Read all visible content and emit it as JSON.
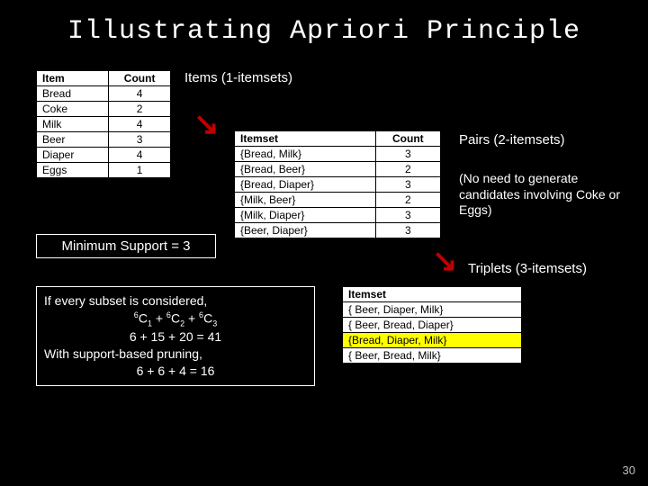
{
  "title": "Illustrating Apriori Principle",
  "labels": {
    "items": "Items (1-itemsets)",
    "pairs": "Pairs (2-itemsets)",
    "triplets": "Triplets (3-itemsets)",
    "note_coke": "(No need to generate candidates involving Coke or Eggs)",
    "minsupport": "Minimum Support = 3"
  },
  "items_table": {
    "headers": [
      "Item",
      "Count"
    ],
    "rows": [
      {
        "item": "Bread",
        "count": "4"
      },
      {
        "item": "Coke",
        "count": "2"
      },
      {
        "item": "Milk",
        "count": "4"
      },
      {
        "item": "Beer",
        "count": "3"
      },
      {
        "item": "Diaper",
        "count": "4"
      },
      {
        "item": "Eggs",
        "count": "1"
      }
    ]
  },
  "pairs_table": {
    "headers": [
      "Itemset",
      "Count"
    ],
    "rows": [
      {
        "itemset": "{Bread, Milk}",
        "count": "3"
      },
      {
        "itemset": "{Bread, Beer}",
        "count": "2"
      },
      {
        "itemset": "{Bread, Diaper}",
        "count": "3"
      },
      {
        "itemset": "{Milk, Beer}",
        "count": "2"
      },
      {
        "itemset": "{Milk, Diaper}",
        "count": "3"
      },
      {
        "itemset": "{Beer, Diaper}",
        "count": "3"
      }
    ]
  },
  "triplets_table": {
    "header": "Itemset",
    "rows": [
      {
        "itemset": "{ Beer, Diaper, Milk}",
        "hl": false
      },
      {
        "itemset": "{ Beer, Bread, Diaper}",
        "hl": false
      },
      {
        "itemset": "{Bread, Diaper, Milk}",
        "hl": true
      },
      {
        "itemset": "{ Beer, Bread, Milk}",
        "hl": false
      }
    ]
  },
  "calc": {
    "line1": "If every subset is considered,",
    "line2a": "6",
    "line2b": "C",
    "line2c": "1",
    "line2d": " + ",
    "line2e": "6",
    "line2f": "C",
    "line2g": "2",
    "line2h": " + ",
    "line2i": "6",
    "line2j": "C",
    "line2k": "3",
    "line3": "6 + 15 + 20 = 41",
    "line4": "With support-based pruning,",
    "line5": "6 + 6 + 4 = 16"
  },
  "pagenum": "30",
  "chart_data": {
    "type": "table",
    "items_1": [
      {
        "Item": "Bread",
        "Count": 4
      },
      {
        "Item": "Coke",
        "Count": 2
      },
      {
        "Item": "Milk",
        "Count": 4
      },
      {
        "Item": "Beer",
        "Count": 3
      },
      {
        "Item": "Diaper",
        "Count": 4
      },
      {
        "Item": "Eggs",
        "Count": 1
      }
    ],
    "pairs_2": [
      {
        "Itemset": "{Bread, Milk}",
        "Count": 3
      },
      {
        "Itemset": "{Bread, Beer}",
        "Count": 2
      },
      {
        "Itemset": "{Bread, Diaper}",
        "Count": 3
      },
      {
        "Itemset": "{Milk, Beer}",
        "Count": 2
      },
      {
        "Itemset": "{Milk, Diaper}",
        "Count": 3
      },
      {
        "Itemset": "{Beer, Diaper}",
        "Count": 3
      }
    ],
    "triplets_3": [
      "{Beer, Diaper, Milk}",
      "{Beer, Bread, Diaper}",
      "{Bread, Diaper, Milk}",
      "{Beer, Bread, Milk}"
    ],
    "minimum_support": 3,
    "total_subsets_without_pruning": 41,
    "total_subsets_with_pruning": 16
  }
}
